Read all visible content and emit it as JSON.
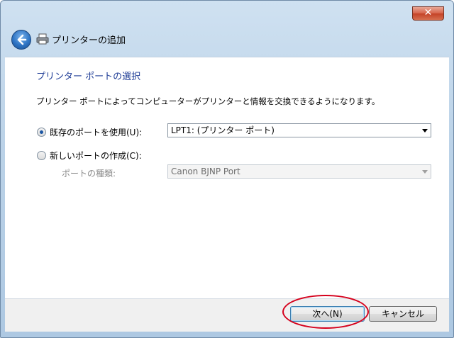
{
  "window": {
    "title": "プリンターの追加",
    "close_label": "✕"
  },
  "section": {
    "title": "プリンター ポートの選択",
    "description": "プリンター ポートによってコンピューターがプリンターと情報を交換できるようになります。"
  },
  "options": {
    "existing_port": {
      "label": "既存のポートを使用(U):",
      "selected": true,
      "value": "LPT1: (プリンター ポート)"
    },
    "new_port": {
      "label": "新しいポートの作成(C):",
      "selected": false,
      "type_label": "ポートの種類:",
      "type_value": "Canon BJNP Port"
    }
  },
  "footer": {
    "next_label": "次へ(N)",
    "cancel_label": "キャンセル"
  },
  "colors": {
    "section_title": "#1e3c96",
    "annotation": "#d5001c"
  }
}
